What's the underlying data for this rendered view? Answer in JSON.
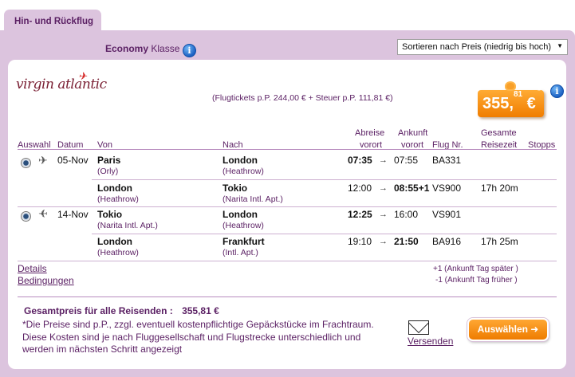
{
  "tab": {
    "label": "Hin- und Rückflug"
  },
  "cabin": {
    "class_name": "Economy",
    "class_suffix": "Klasse"
  },
  "sort": {
    "selected": "Sortieren nach Preis (niedrig bis hoch)"
  },
  "airline": {
    "logo_text": "virgin atlantic"
  },
  "fare": {
    "breakdown": "(Flugtickets p.P. 244,00 € + Steuer p.P. 111,81 €)",
    "price_main": "355,",
    "price_cents": "81",
    "currency": "€",
    "marker": "*"
  },
  "columns": {
    "select": "Auswahl",
    "date": "Datum",
    "from": "Von",
    "to": "Nach",
    "dep_l1": "Abreise",
    "dep_l2": "vorort",
    "arr_l1": "Ankunft",
    "arr_l2": "vorort",
    "flight": "Flug Nr.",
    "total_l1": "Gesamte",
    "total_l2": "Reisezeit",
    "stops": "Stopps"
  },
  "segments": [
    {
      "date": "05-Nov",
      "from": "Paris",
      "from_sub": "(Orly)",
      "to": "London",
      "to_sub": "(Heathrow)",
      "dep": "07:35",
      "arr": "07:55",
      "flight": "BA331",
      "duration": ""
    },
    {
      "date": "",
      "from": "London",
      "from_sub": "(Heathrow)",
      "to": "Tokio",
      "to_sub": "(Narita Intl. Apt.)",
      "dep": "12:00",
      "arr": "08:55+1",
      "flight": "VS900",
      "duration": "17h 20m"
    },
    {
      "date": "14-Nov",
      "from": "Tokio",
      "from_sub": "(Narita Intl. Apt.)",
      "to": "London",
      "to_sub": "(Heathrow)",
      "dep": "12:25",
      "arr": "16:00",
      "flight": "VS901",
      "duration": ""
    },
    {
      "date": "",
      "from": "London",
      "from_sub": "(Heathrow)",
      "to": "Frankfurt",
      "to_sub": "(Intl. Apt.)",
      "dep": "19:10",
      "arr": "21:50",
      "flight": "BA916",
      "duration": "17h 25m"
    }
  ],
  "links": {
    "details": "Details",
    "conditions": "Bedingungen"
  },
  "notes": {
    "plus_one": "+1 (Ankunft Tag später )",
    "minus_one": "-1 (Ankunft Tag früher )"
  },
  "footer": {
    "total_label": "Gesamtpreis für alle Reisenden :",
    "total_value": "355,81 €",
    "disclaimer_1": "*Die Preise sind p.P., zzgl. eventuell kostenpflichtige Gepäckstücke im Frachtraum.",
    "disclaimer_2": "Diese Kosten sind je nach Fluggesellschaft und Flugstrecke unterschiedlich und",
    "disclaimer_3": "werden im nächsten Schritt angezeigt",
    "send_label": "Versenden",
    "select_label": "Auswählen ➜"
  },
  "colors": {
    "accent_purple": "#5a1f63",
    "frame_lilac": "#dcc4de",
    "price_orange": "#f07d00"
  },
  "icons": [
    "info-icon",
    "radio-selected",
    "plane-icon",
    "envelope-icon",
    "price-tag-icon"
  ]
}
